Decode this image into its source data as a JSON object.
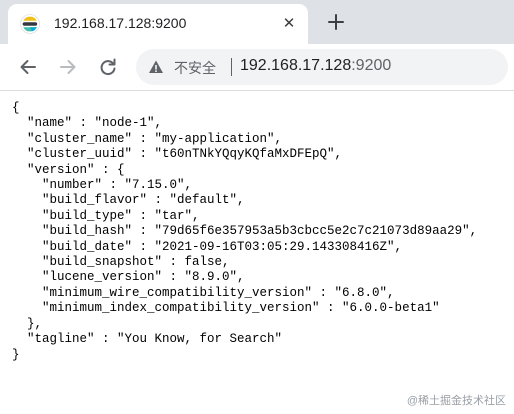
{
  "tab": {
    "title": "192.168.17.128:9200",
    "favicon": "elasticsearch-icon"
  },
  "toolbar": {
    "back_icon": "back-arrow-icon",
    "forward_icon": "forward-arrow-icon",
    "reload_icon": "reload-icon"
  },
  "address_bar": {
    "security_icon": "warning-triangle-icon",
    "security_label": "不安全",
    "url_host": "192.168.17.128",
    "url_port": ":9200"
  },
  "content": {
    "json_lines": [
      "{",
      "  \"name\" : \"node-1\",",
      "  \"cluster_name\" : \"my-application\",",
      "  \"cluster_uuid\" : \"t60nTNkYQqyKQfaMxDFEpQ\",",
      "  \"version\" : {",
      "    \"number\" : \"7.15.0\",",
      "    \"build_flavor\" : \"default\",",
      "    \"build_type\" : \"tar\",",
      "    \"build_hash\" : \"79d65f6e357953a5b3cbcc5e2c7c21073d89aa29\",",
      "    \"build_date\" : \"2021-09-16T03:05:29.143308416Z\",",
      "    \"build_snapshot\" : false,",
      "    \"lucene_version\" : \"8.9.0\",",
      "    \"minimum_wire_compatibility_version\" : \"6.8.0\",",
      "    \"minimum_index_compatibility_version\" : \"6.0.0-beta1\"",
      "  },",
      "  \"tagline\" : \"You Know, for Search\"",
      "}"
    ]
  },
  "watermark": "@稀土掘金技术社区",
  "colors": {
    "tabstrip_bg": "#dee1e6",
    "omnibox_bg": "#f1f3f4",
    "icon_gray": "#5f6368",
    "favicon_yellow": "#f0bf1a",
    "favicon_teal": "#3ebeb0",
    "favicon_blue": "#07a5de"
  }
}
